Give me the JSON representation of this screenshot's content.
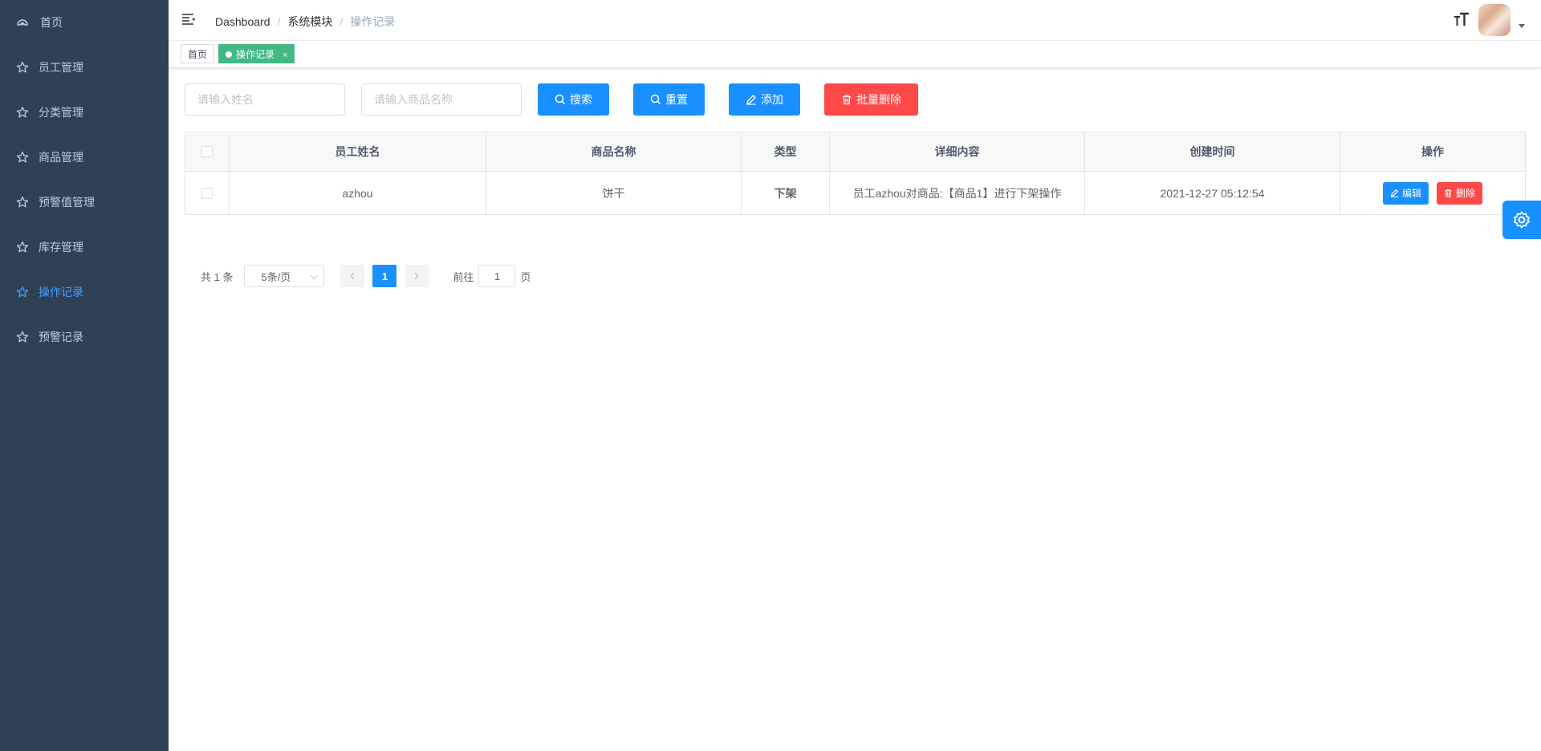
{
  "sidebar": {
    "items": [
      {
        "label": "首页",
        "icon": "dashboard-icon",
        "active": false
      },
      {
        "label": "员工管理",
        "icon": "star-icon",
        "active": false
      },
      {
        "label": "分类管理",
        "icon": "star-icon",
        "active": false
      },
      {
        "label": "商品管理",
        "icon": "star-icon",
        "active": false
      },
      {
        "label": "预警值管理",
        "icon": "star-icon",
        "active": false
      },
      {
        "label": "库存管理",
        "icon": "star-icon",
        "active": false
      },
      {
        "label": "操作记录",
        "icon": "star-icon",
        "active": true
      },
      {
        "label": "预警记录",
        "icon": "star-icon",
        "active": false
      }
    ]
  },
  "header": {
    "breadcrumb": [
      "Dashboard",
      "系统模块",
      "操作记录"
    ]
  },
  "tags": {
    "items": [
      {
        "label": "首页",
        "active": false
      },
      {
        "label": "操作记录",
        "active": true,
        "close": "×"
      }
    ]
  },
  "filters": {
    "name_placeholder": "请输入姓名",
    "product_placeholder": "请输入商品名称"
  },
  "toolbar": {
    "search_label": "搜索",
    "reset_label": "重置",
    "add_label": "添加",
    "batch_delete_label": "批量删除"
  },
  "table": {
    "columns": [
      "员工姓名",
      "商品名称",
      "类型",
      "详细内容",
      "创建时间",
      "操作"
    ],
    "rows": [
      {
        "name": "azhou",
        "product": "饼干",
        "type": "下架",
        "detail": "员工azhou对商品:【商品1】进行下架操作",
        "created": "2021-12-27 05:12:54",
        "edit_label": "编辑",
        "delete_label": "删除"
      }
    ]
  },
  "pagination": {
    "total_text": "共 1 条",
    "page_size": "5条/页",
    "current_page": "1",
    "goto_prefix": "前往",
    "goto_value": "1",
    "goto_suffix": "页"
  },
  "colors": {
    "sidebar_bg": "#304156",
    "primary": "#1890ff",
    "danger": "#ff4949",
    "tag_active": "#42b983"
  }
}
